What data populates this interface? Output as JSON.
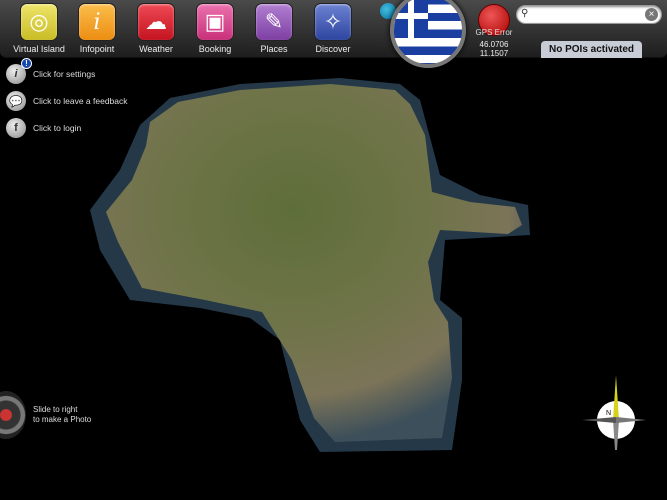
{
  "apps": [
    {
      "label": "Virtual Island",
      "icon": "virtual-island-icon",
      "color": "#d9cf3c",
      "glyph": "◎"
    },
    {
      "label": "Infopoint",
      "icon": "info-icon",
      "color": "#f3a023",
      "glyph": "i"
    },
    {
      "label": "Weather",
      "icon": "weather-icon",
      "color": "#d9222e",
      "glyph": "☁"
    },
    {
      "label": "Booking",
      "icon": "suitcase-icon",
      "color": "#d8468c",
      "glyph": "▣"
    },
    {
      "label": "Places",
      "icon": "pushpin-icon",
      "color": "#8e52b3",
      "glyph": "📌"
    },
    {
      "label": "Discover",
      "icon": "compass-icon",
      "color": "#3d55b0",
      "glyph": "✧"
    }
  ],
  "gps": {
    "status": "GPS Error",
    "lat": "46.0706",
    "lon": "11.1507"
  },
  "search": {
    "value": "",
    "placeholder": ""
  },
  "poi_status": "No POIs activated",
  "side": {
    "settings": "Click for settings",
    "feedback": "Click to leave a feedback",
    "login": "Click to login"
  },
  "photo": {
    "line1": "Slide to right",
    "line2": "to make a Photo"
  },
  "compass_n": "N"
}
